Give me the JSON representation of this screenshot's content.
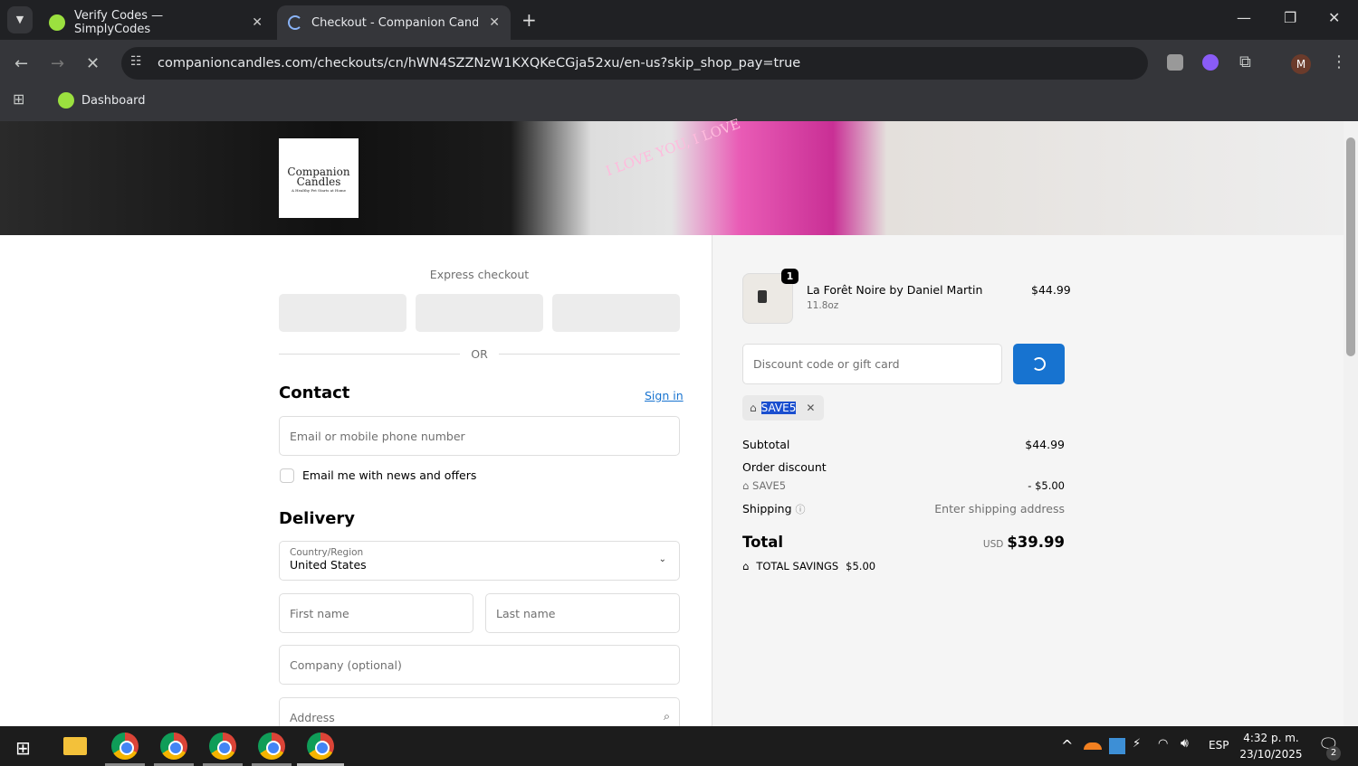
{
  "browser": {
    "tabs": [
      {
        "title": "Verify Codes — SimplyCodes",
        "active": false
      },
      {
        "title": "Checkout - Companion Candle",
        "active": true
      }
    ],
    "url": "companioncandles.com/checkouts/cn/hWN4SZZNzW1KXQKeCGja52xu/en-us?skip_shop_pay=true",
    "bookmarks": [
      {
        "label": "Dashboard"
      }
    ],
    "profile_initial": "M"
  },
  "header": {
    "logo_line1": "Companion",
    "logo_line2": "Candles",
    "logo_tagline": "A Healthy Pet Starts at Home",
    "banner_text": "I LOVE YOU, I LOVE"
  },
  "checkout": {
    "express_title": "Express checkout",
    "or_label": "OR",
    "contact": {
      "title": "Contact",
      "sign_in": "Sign in",
      "email_placeholder": "Email or mobile phone number",
      "newsletter_label": "Email me with news and offers",
      "newsletter_checked": false
    },
    "delivery": {
      "title": "Delivery",
      "country_label": "Country/Region",
      "country_value": "United States",
      "first_name": "First name",
      "last_name": "Last name",
      "company": "Company (optional)",
      "address": "Address"
    }
  },
  "summary": {
    "item": {
      "quantity": "1",
      "name": "La Forêt Noire by Daniel Martin",
      "variant": "11.8oz",
      "price": "$44.99"
    },
    "discount_placeholder": "Discount code or gift card",
    "applied_code": "SAVE5",
    "subtotal_label": "Subtotal",
    "subtotal": "$44.99",
    "order_discount_label": "Order discount",
    "discount_code": "SAVE5",
    "discount_amount": "- $5.00",
    "shipping_label": "Shipping",
    "shipping_value": "Enter shipping address",
    "total_label": "Total",
    "currency": "USD",
    "total": "$39.99",
    "savings_label": "TOTAL SAVINGS",
    "savings": "$5.00"
  },
  "taskbar": {
    "language": "ESP",
    "time": "4:32 p. m.",
    "date": "23/10/2025",
    "notifications": "2"
  },
  "colors": {
    "accent": "#1773d0",
    "panel": "#f5f5f5"
  }
}
